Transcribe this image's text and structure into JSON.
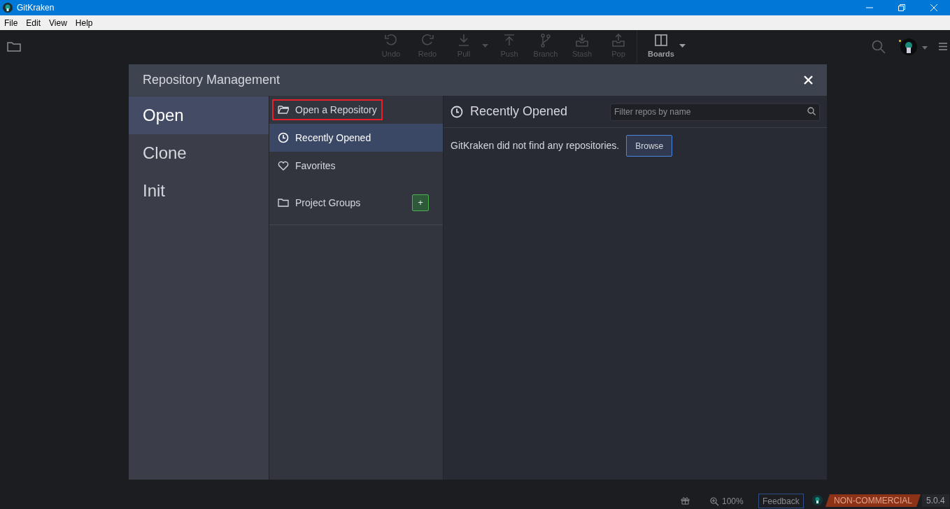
{
  "window": {
    "title": "GitKraken"
  },
  "menu": [
    "File",
    "Edit",
    "View",
    "Help"
  ],
  "toolbar": [
    {
      "label": "Undo",
      "kind": "undo",
      "disabled": true,
      "dropdown": false
    },
    {
      "label": "Redo",
      "kind": "redo",
      "disabled": true,
      "dropdown": false
    },
    {
      "label": "Pull",
      "kind": "pull",
      "disabled": true,
      "dropdown": true
    },
    {
      "label": "Push",
      "kind": "push",
      "disabled": true,
      "dropdown": false
    },
    {
      "label": "Branch",
      "kind": "branch",
      "disabled": true,
      "dropdown": false
    },
    {
      "label": "Stash",
      "kind": "stash",
      "disabled": true,
      "dropdown": false
    },
    {
      "label": "Pop",
      "kind": "pop",
      "disabled": true,
      "dropdown": false
    },
    {
      "label": "Boards",
      "kind": "boards",
      "disabled": false,
      "dropdown": true
    }
  ],
  "dialog": {
    "title": "Repository Management",
    "tabs": [
      {
        "label": "Open",
        "selected": true
      },
      {
        "label": "Clone",
        "selected": false
      },
      {
        "label": "Init",
        "selected": false
      }
    ],
    "nav": [
      {
        "label": "Open a Repository",
        "kind": "open",
        "selected": false,
        "highlighted": true
      },
      {
        "label": "Recently Opened",
        "kind": "recent",
        "selected": true,
        "highlighted": false
      },
      {
        "label": "Favorites",
        "kind": "favorites",
        "selected": false,
        "highlighted": false
      },
      {
        "label": "Project Groups",
        "kind": "groups",
        "selected": false,
        "highlighted": false,
        "add_button": "+"
      }
    ],
    "panel": {
      "title": "Recently Opened",
      "filter_placeholder": "Filter repos by name",
      "message": "GitKraken did not find any repositories.",
      "button": "Browse"
    }
  },
  "status_bar": {
    "zoom": "100%",
    "feedback": "Feedback",
    "license": "NON-COMMERCIAL",
    "version": "5.0.4"
  }
}
